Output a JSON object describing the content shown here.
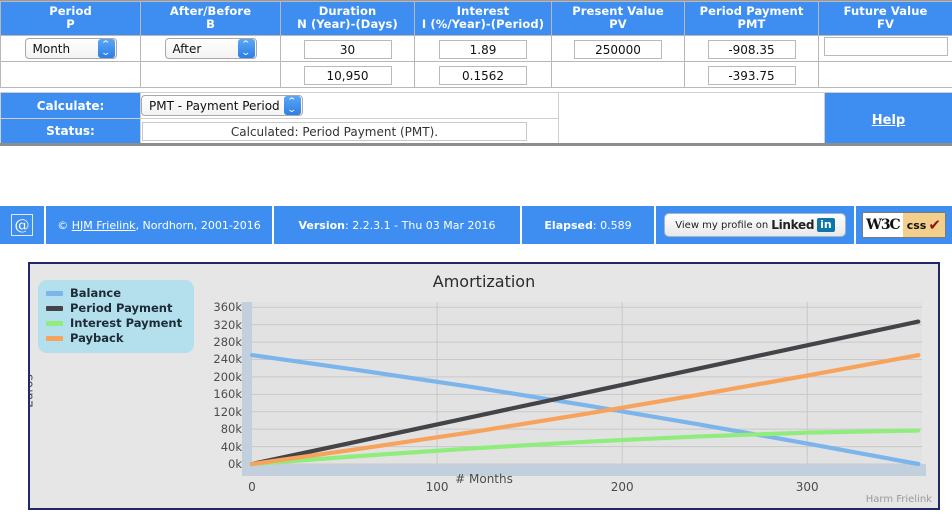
{
  "table": {
    "columns": [
      {
        "title": "Period",
        "sub": "P"
      },
      {
        "title": "After/Before",
        "sub": "B"
      },
      {
        "title": "Duration",
        "sub": "N (Year)-(Days)"
      },
      {
        "title": "Interest",
        "sub": "I (%/Year)-(Period)"
      },
      {
        "title": "Present Value",
        "sub": "PV"
      },
      {
        "title": "Period Payment",
        "sub": "PMT"
      },
      {
        "title": "Future Value",
        "sub": "FV"
      }
    ],
    "row1": {
      "period": "Month",
      "after_before": "After",
      "duration": "30",
      "interest": "1.89",
      "present_value": "250000",
      "period_payment": "-908.35",
      "future_value": ""
    },
    "row2": {
      "period": "",
      "after_before": "",
      "duration": "10,950",
      "interest": "0.1562",
      "present_value": "",
      "period_payment": "-393.75",
      "future_value": ""
    }
  },
  "controls": {
    "calculate_label": "Calculate:",
    "calculate_value": "PMT - Payment Period",
    "status_label": "Status:",
    "status_value": "Calculated: Period Payment (PMT).",
    "help_label": "Help"
  },
  "footer": {
    "at_icon": "@",
    "copyright_prefix": "©",
    "copyright_link": "HJM Frielink",
    "copyright_rest": ", Nordhorn, 2001-2016",
    "version_label": "Version",
    "version_value": "2.2.3.1 - Thu 03 Mar 2016",
    "elapsed_label": "Elapsed",
    "elapsed_value": "0.589",
    "linkedin_text": "View my profile on",
    "linkedin_brand": "Linked",
    "linkedin_in": "in",
    "w3c_left": "W3C",
    "w3c_right": "css",
    "w3c_check": "✔"
  },
  "chart_data": {
    "type": "line",
    "title": "Amortization",
    "xlabel": "# Months",
    "ylabel": "Euros",
    "watermark": "Harm Frielink",
    "grid": true,
    "legend_position": "top-left",
    "xlim": [
      0,
      362
    ],
    "ylim": [
      0,
      372
    ],
    "xticks": [
      0,
      100,
      200,
      300
    ],
    "xtick_labels": [
      "0",
      "100",
      "200",
      "300"
    ],
    "yticks": [
      0,
      40,
      80,
      120,
      160,
      200,
      240,
      280,
      320,
      360
    ],
    "ytick_labels": [
      "0k",
      "40k",
      "80k",
      "120k",
      "160k",
      "200k",
      "240k",
      "280k",
      "320k",
      "360k"
    ],
    "y_unit": "thousand Euros",
    "colors": {
      "balance": "#7cb5ec",
      "period_payment": "#434348",
      "interest_payment": "#90ed7d",
      "payback": "#f7a35c",
      "plot_bg": "#e2e2e2",
      "panel_bg": "#e6e6e6",
      "legend_bg": "#b4e0ee",
      "navigator_bg": "#c2d0dd",
      "panel_border": "#1f2a64"
    },
    "series": [
      {
        "name": "Balance",
        "color": "#7cb5ec",
        "x": [
          0,
          60,
          120,
          180,
          240,
          300,
          360
        ],
        "values": [
          250,
          214,
          176,
          135,
          92,
          47,
          0
        ]
      },
      {
        "name": "Period Payment",
        "color": "#434348",
        "x": [
          0,
          60,
          120,
          180,
          240,
          300,
          360
        ],
        "values": [
          0,
          54.5,
          109,
          163.5,
          218,
          272.5,
          327
        ]
      },
      {
        "name": "Interest Payment",
        "color": "#90ed7d",
        "x": [
          0,
          60,
          120,
          180,
          240,
          300,
          360
        ],
        "values": [
          0,
          19,
          36,
          51,
          63,
          72,
          77
        ]
      },
      {
        "name": "Payback",
        "color": "#f7a35c",
        "x": [
          0,
          60,
          120,
          180,
          240,
          300,
          360
        ],
        "values": [
          0,
          36,
          74,
          115,
          158,
          203,
          250
        ]
      }
    ]
  }
}
